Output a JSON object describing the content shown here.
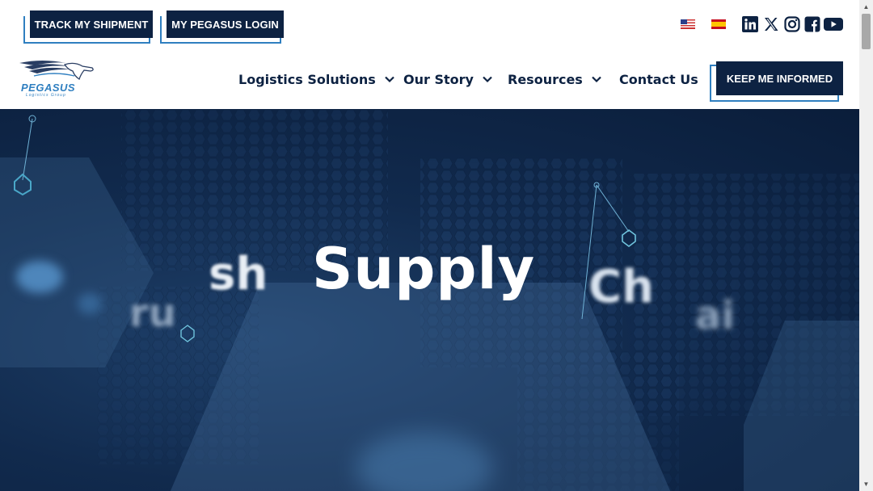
{
  "topbar": {
    "track_label": "TRACK MY SHIPMENT",
    "login_label": "MY PEGASUS LOGIN",
    "languages": [
      {
        "name": "English",
        "icon": "us-flag-icon"
      },
      {
        "name": "Spanish",
        "icon": "spain-flag-icon"
      }
    ],
    "social": [
      "linkedin-icon",
      "x-icon",
      "instagram-icon",
      "facebook-icon",
      "youtube-icon"
    ]
  },
  "logo": {
    "name": "PEGASUS",
    "sub": "Logistics Group"
  },
  "nav": {
    "items": [
      {
        "label": "Logistics Solutions",
        "has_dropdown": true
      },
      {
        "label": "Our Story",
        "has_dropdown": true
      },
      {
        "label": "Resources",
        "has_dropdown": true
      },
      {
        "label": "Contact Us",
        "has_dropdown": false
      }
    ],
    "cta_label": "KEEP ME INFORMED"
  },
  "hero": {
    "word_far_left": "ru",
    "word_left": "sh",
    "word_main": "Supply",
    "word_right": "Ch",
    "word_far_right": "ai"
  },
  "colors": {
    "brand_navy": "#0d2242",
    "accent_blue": "#2f7fc0",
    "hero_bg": "#112a4d"
  }
}
